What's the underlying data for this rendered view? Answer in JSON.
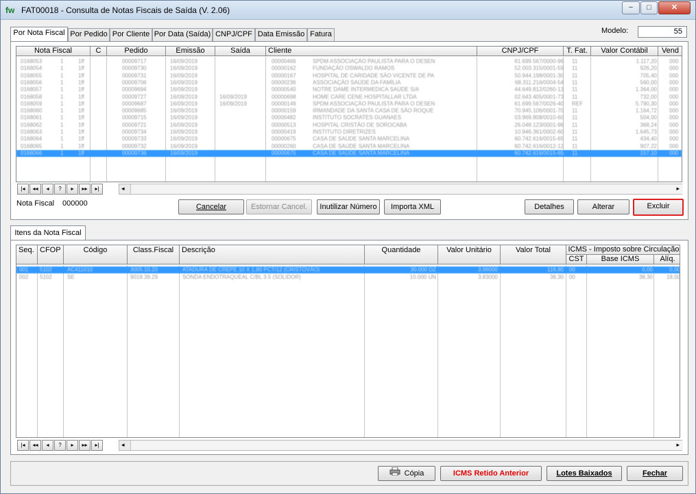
{
  "window": {
    "icon_text": "fw",
    "title": "FAT00018 - Consulta de Notas Fiscais de Saída (V. 2.06)"
  },
  "window_controls": {
    "minimize": "−",
    "maximize": "□",
    "close": "✕"
  },
  "tabs": [
    {
      "label": "Por Nota Fiscal",
      "active": true
    },
    {
      "label": "Por Pedido"
    },
    {
      "label": "Por Cliente"
    },
    {
      "label": "Por Data (Saída)"
    },
    {
      "label": "CNPJ/CPF"
    },
    {
      "label": "Data Emissão"
    },
    {
      "label": "Fatura"
    }
  ],
  "modelo": {
    "label": "Modelo:",
    "value": "55"
  },
  "nf_grid": {
    "headers": [
      "Nota Fiscal",
      "C",
      "Pedido",
      "Emissão",
      "Saída",
      "Cliente",
      "CNPJ/CPF",
      "T. Fat.",
      "Valor Contábil",
      "Vend"
    ],
    "rows": [
      [
        "0168053",
        "1",
        "1ff",
        "00009717",
        "16/09/2019",
        "",
        "00000466",
        "SPDM ASSOCIAÇÃO PAULISTA PARA O DESEN",
        "61.699.567/0000-96",
        "11",
        "1.117,20",
        "000"
      ],
      [
        "0168054",
        "1",
        "1ff",
        "00009730",
        "16/09/2019",
        "",
        "00000162",
        "FUNDAÇÃO OSWALDO RAMOS",
        "52.003.315/0001-59",
        "11",
        "926,20",
        "000"
      ],
      [
        "0168055",
        "1",
        "1ff",
        "00009731",
        "16/09/2019",
        "",
        "00000167",
        "HOSPITAL DE CARIDADE SÃO VICENTE DE PA",
        "50.944.198/0001-30",
        "11",
        "705,40",
        "000"
      ],
      [
        "0168056",
        "1",
        "1ff",
        "00009706",
        "16/09/2019",
        "",
        "00000236",
        "ASSOCIAÇÃO SAÚDE DA FAMÍLIA",
        "68.311.216/0004-54",
        "11",
        "560,00",
        "000"
      ],
      [
        "0168057",
        "1",
        "1ff",
        "00009694",
        "16/09/2019",
        "",
        "00000540",
        "NOTRE DAME INTERMEDICA SAÚDE S/A",
        "44.649.812/0260-13",
        "11",
        "1.364,00",
        "000"
      ],
      [
        "0168058",
        "1",
        "1ff",
        "00009727",
        "16/09/2019",
        "16/09/2019",
        "00000698",
        "HOME CARE CENE HOSPITALLAR LTDA",
        "02.643.405/0001-73",
        "11",
        "732,00",
        "000"
      ],
      [
        "0168059",
        "1",
        "1ff",
        "00009687",
        "16/09/2019",
        "16/09/2019",
        "00000149",
        "SPDM ASSOCIAÇÃO PAULISTA PARA O DESEN",
        "61.699.567/0026-40",
        "REF",
        "5.790,30",
        "000"
      ],
      [
        "0168060",
        "1",
        "1ff",
        "00009685",
        "16/09/2019",
        "",
        "00000159",
        "IRMANDADE DA SANTA CASA DE SÃO ROQUE",
        "70.945.106/0001-70",
        "11",
        "1.164,72",
        "000"
      ],
      [
        "0168061",
        "1",
        "1ff",
        "00009715",
        "16/09/2019",
        "",
        "00000482",
        "INSTITUTO SOCRATES GUANAES",
        "03.969.808/0010-60",
        "11",
        "504,00",
        "000"
      ],
      [
        "0168062",
        "1",
        "1ff",
        "00009721",
        "16/09/2019",
        "",
        "00000513",
        "HOSPITAL CRISTÃO DE SOROCABA",
        "26.048.123/0001-96",
        "11",
        "368,24",
        "000"
      ],
      [
        "0168063",
        "1",
        "1ff",
        "00009734",
        "16/09/2019",
        "",
        "00000419",
        "INSTITUTO DIRETRIZES",
        "10.946.361/0002-60",
        "11",
        "1.645,73",
        "000"
      ],
      [
        "0168064",
        "1",
        "1ff",
        "00009733",
        "16/09/2019",
        "",
        "00000675",
        "CASA DE SAÚDE SANTA MARCELINA",
        "60.742.616/0015-65",
        "11",
        "434,40",
        "000"
      ],
      [
        "0168065",
        "1",
        "1ff",
        "00009732",
        "16/09/2019",
        "",
        "00000260",
        "CASA DE SAÚDE SANTA MARCELINA",
        "60.742.616/0012-12",
        "11",
        "907,22",
        "000"
      ],
      [
        "0168066",
        "1",
        "1ff",
        "00009736",
        "16/09/2019",
        "",
        "00000675",
        "CASA DE SAÚDE SANTA MARCELINA",
        "60.742.616/0015-65",
        "11",
        "157,10",
        "000"
      ]
    ],
    "nav": [
      "|◂",
      "◂◂",
      "◂",
      "?",
      "▸",
      "▸▸",
      "▸|"
    ]
  },
  "nf_footer": {
    "label": "Nota Fiscal",
    "value": "000000"
  },
  "actions": {
    "cancelar": "Cancelar",
    "estornar": "Estornar Cancel.",
    "inutilizar": "Inutilizar Número",
    "importa": "Importa XML",
    "detalhes": "Detalhes",
    "alterar": "Alterar",
    "excluir": "Excluir"
  },
  "items_tab": {
    "label": "Itens da Nota Fiscal"
  },
  "items_grid": {
    "headers": [
      "Seq.",
      "CFOP",
      "Código",
      "Class.Fiscal",
      "Descrição",
      "Quantidade",
      "Valor Unitário",
      "Valor Total"
    ],
    "icms_group": "ICMS - Imposto sobre Circulação",
    "icms_subheaders": [
      "CST",
      "Base ICMS",
      "Alíq."
    ],
    "rows": [
      [
        "001",
        "5102",
        "AC411010",
        "3005.10.20",
        "ATADURA DE CREPE 10 X 1,80 PCT/12 (CRISTÓVÃO)",
        "30.000 DZ",
        "3,96000",
        "118,80",
        "00",
        "0,00",
        "0,00"
      ],
      [
        "002",
        "5102",
        "SE",
        "9018.39.29",
        "SONDA ENDOTRAQUEAL C/BL 3.5 (SOLIDOR)",
        "10.000 UN",
        "3,83000",
        "38,30",
        "00",
        "38,30",
        "18,00"
      ]
    ]
  },
  "bottom_buttons": {
    "copia": "Cópia",
    "icms_retido": "ICMS Retido Anterior",
    "lotes": "Lotes Baixados",
    "fechar": "Fechar"
  },
  "colors": {
    "selection": "#3399ff",
    "danger": "#e02020",
    "icms_text": "#e00000"
  }
}
